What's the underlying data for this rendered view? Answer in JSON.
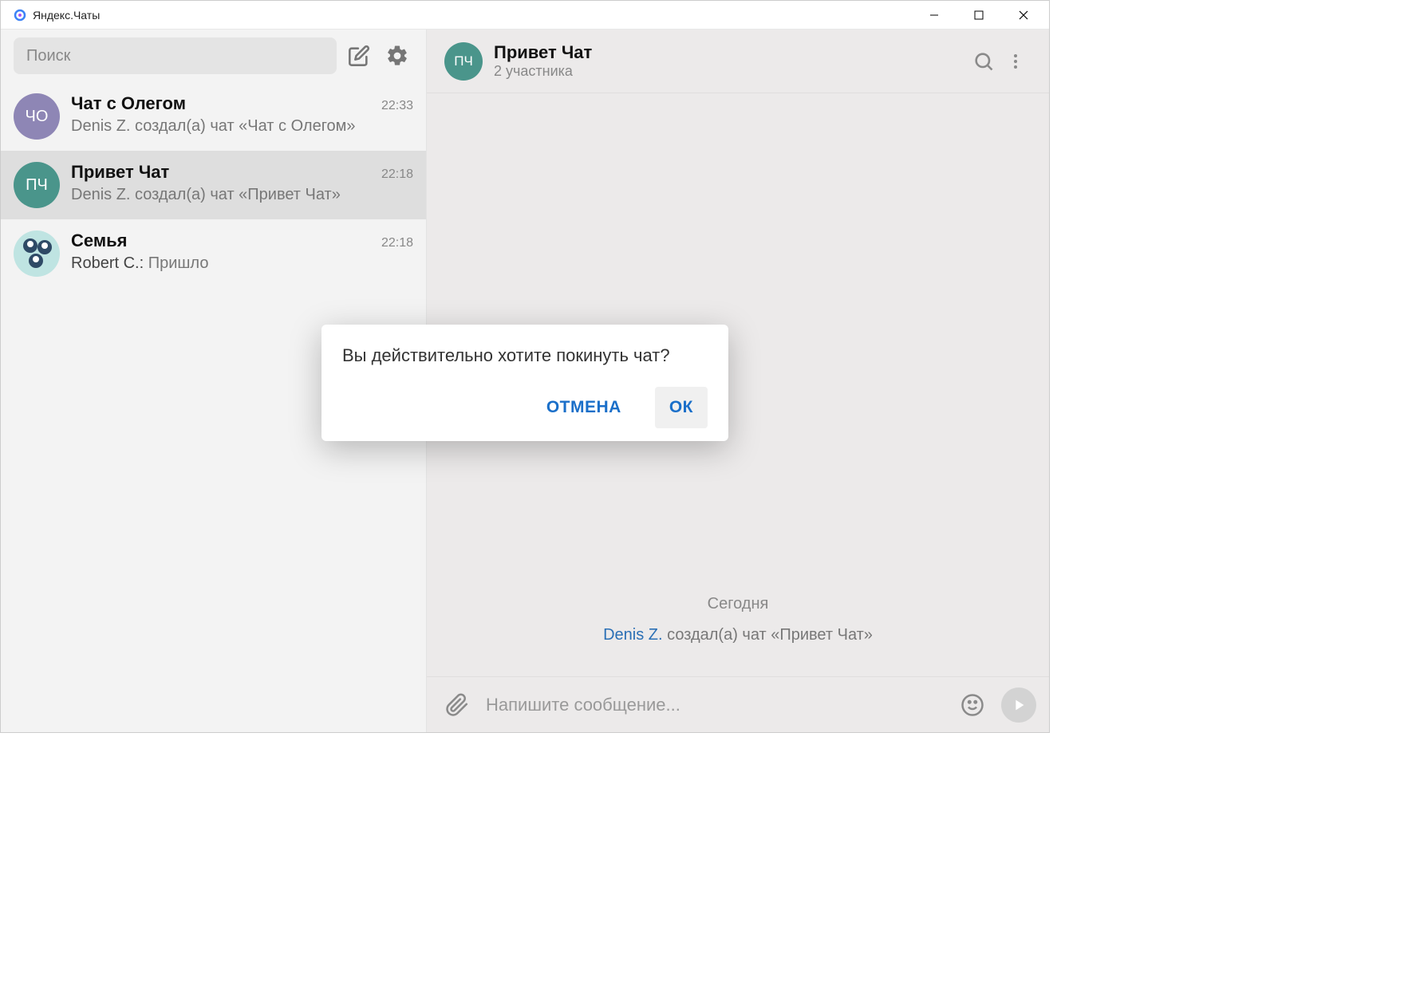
{
  "app": {
    "title": "Яндекс.Чаты"
  },
  "sidebar": {
    "search_placeholder": "Поиск",
    "chats": [
      {
        "avatar_text": "ЧО",
        "avatar_bg": "#8e86b5",
        "title": "Чат с Олегом",
        "time": "22:33",
        "subtitle": "Denis Z. создал(а) чат «Чат с Олегом»",
        "selected": false
      },
      {
        "avatar_text": "ПЧ",
        "avatar_bg": "#4a958b",
        "title": "Привет Чат",
        "time": "22:18",
        "subtitle": "Denis Z. создал(а) чат «Привет Чат»",
        "selected": true
      },
      {
        "avatar_text": "family-icon",
        "avatar_bg": "#bfe4e2",
        "title": "Семья",
        "time": "22:18",
        "sender": "Robert C.:",
        "message": "Пришло",
        "selected": false
      }
    ]
  },
  "main": {
    "header": {
      "avatar_text": "ПЧ",
      "avatar_bg": "#4a958b",
      "title": "Привет Чат",
      "subtitle": "2 участника"
    },
    "date_separator": "Сегодня",
    "system_message": {
      "author": "Denis Z.",
      "text": " создал(а) чат «Привет Чат»"
    },
    "composer_placeholder": "Напишите сообщение..."
  },
  "modal": {
    "text": "Вы действительно хотите покинуть чат?",
    "cancel": "ОТМЕНА",
    "ok": "ОК"
  }
}
